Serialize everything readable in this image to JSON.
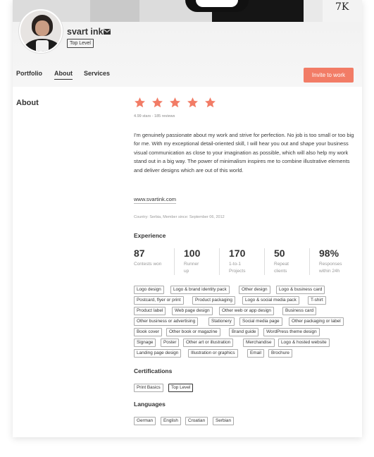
{
  "profile": {
    "name": "svart ink",
    "level_badge": "Top Level"
  },
  "nav": {
    "tabs": [
      {
        "label": "Portfolio"
      },
      {
        "label": "About",
        "active": true
      },
      {
        "label": "Services"
      }
    ],
    "invite_label": "Invite to work",
    "accent_color": "#f27c66"
  },
  "about": {
    "section_title": "About",
    "rating": {
      "stars": 5,
      "text": "4.99 stars - 185 reviews",
      "star_color": "#f27c66"
    },
    "bio": "I'm genuinely passionate about my work and strive for perfection. No job is too small or too big for me. With my exceptional detail-oriented skill, I will hear you out and shape your business visual communication as close to your imagination as possible, which will also help my work stand out in a big way. The power of minimalism inspires me to combine illustrative elements and deliver designs which are out of this world.",
    "website": "www.svartink.com",
    "country_line": "Country: Serbia, Member since: September 06, 2012"
  },
  "experience": {
    "title": "Experience",
    "stats": [
      {
        "value": "87",
        "label": "Contests won"
      },
      {
        "value": "100",
        "label": "Runner up"
      },
      {
        "value": "170",
        "label": "1-to-1 Projects"
      },
      {
        "value": "50",
        "label": "Repeat clients"
      },
      {
        "value": "98%",
        "label": "Responses within 24h"
      }
    ],
    "tags": [
      "Logo design",
      "Logo & brand identity pack",
      "Other design",
      "Logo & business card",
      "Postcard, flyer or print",
      "Product packaging",
      "Logo & social media pack",
      "T-shirt",
      "Product label",
      "Web page design",
      "Other web or app design",
      "Business card",
      "Other business or advertising",
      "Stationery",
      "Social media page",
      "Other packaging or label",
      "Book cover",
      "Other book or magazine",
      "Brand guide",
      "WordPress theme design",
      "Signage",
      "Poster",
      "Other art or illustration",
      "Merchandise",
      "Logo & hosted website",
      "Landing page design",
      "Illustration or graphics",
      "Email",
      "Brochure"
    ]
  },
  "certifications": {
    "title": "Certifications",
    "items": [
      "Print Basics",
      "Top Level"
    ]
  },
  "languages": {
    "title": "Languages",
    "items": [
      "German",
      "English",
      "Croatian",
      "Serbian"
    ]
  }
}
